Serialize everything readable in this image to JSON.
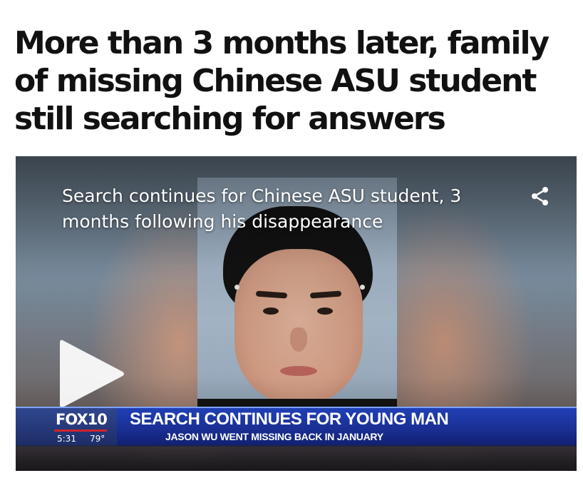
{
  "article": {
    "headline": "More than 3 months later, family of missing Chinese ASU student still searching for answers"
  },
  "video": {
    "caption": "Search continues for Chinese ASU student, 3 months following his disappearance",
    "share_icon": "share-icon",
    "play_icon": "play-icon",
    "lower_third": {
      "brand": "FOX10",
      "time": "5:31",
      "temperature": "79°",
      "headline": "SEARCH CONTINUES FOR YOUNG MAN",
      "subline": "JASON WU WENT MISSING BACK IN JANUARY"
    }
  },
  "colors": {
    "headline_text": "#111111",
    "lower_third_blue": "#1a2f93",
    "fox_red": "#d2232a"
  }
}
